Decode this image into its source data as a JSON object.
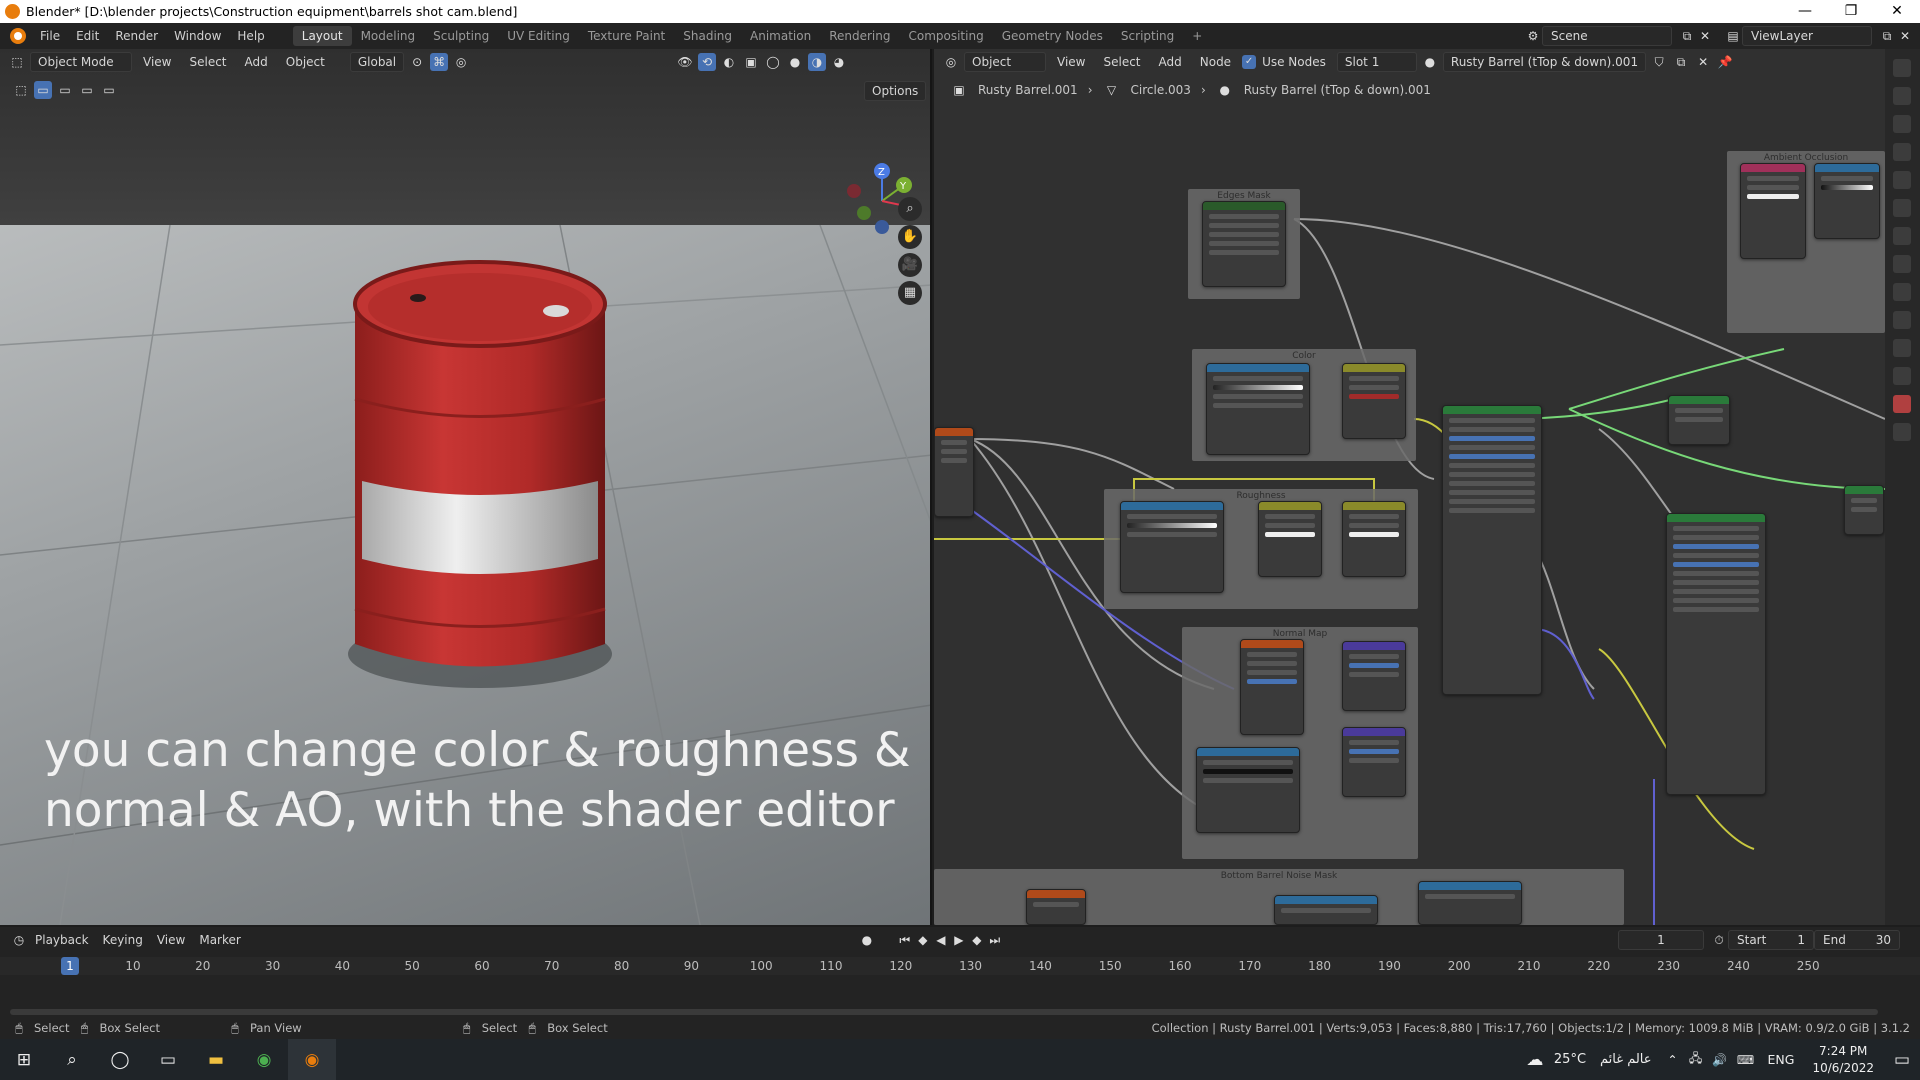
{
  "window": {
    "title": "Blender* [D:\\blender projects\\Construction equipment\\barrels shot cam.blend]",
    "minimize": "—",
    "maximize": "❐",
    "close": "✕"
  },
  "menu": [
    "File",
    "Edit",
    "Render",
    "Window",
    "Help"
  ],
  "workspaces": [
    "Layout",
    "Modeling",
    "Sculpting",
    "UV Editing",
    "Texture Paint",
    "Shading",
    "Animation",
    "Rendering",
    "Compositing",
    "Geometry Nodes",
    "Scripting",
    "+"
  ],
  "scene": {
    "label": "Scene",
    "viewlayer": "ViewLayer"
  },
  "viewport": {
    "mode": "Object Mode",
    "menu": [
      "View",
      "Select",
      "Add",
      "Object"
    ],
    "transform": "Global",
    "options": "Options",
    "overlay_text": "you can change color & roughness & normal & AO, with the shader editor",
    "gizmo": {
      "z": "Z",
      "y": "Y",
      "x": "X"
    }
  },
  "node_editor": {
    "object": "Object",
    "menu": [
      "View",
      "Select",
      "Add",
      "Node"
    ],
    "use_nodes": "Use Nodes",
    "slot": "Slot 1",
    "material": "Rusty Barrel (tTop & down).001",
    "breadcrumb": [
      "Rusty Barrel.001",
      "Circle.003",
      "Rusty Barrel (tTop & down).001"
    ],
    "frames": [
      "Edges Mask",
      "Color",
      "Roughness",
      "Normal Map",
      "Ambient Occlusion",
      "Bottom Barrel Noise Mask"
    ]
  },
  "timeline": {
    "menu": [
      "Playback",
      "Keying",
      "View",
      "Marker"
    ],
    "current_frame": "1",
    "start_label": "Start",
    "start": "1",
    "end_label": "End",
    "end": "30",
    "ticks": [
      "1",
      "10",
      "20",
      "30",
      "40",
      "50",
      "60",
      "70",
      "80",
      "90",
      "100",
      "110",
      "120",
      "130",
      "140",
      "150",
      "160",
      "170",
      "180",
      "190",
      "200",
      "210",
      "220",
      "230",
      "240",
      "250"
    ]
  },
  "status": {
    "left": [
      "Select",
      "Box Select",
      "Pan View",
      "Select",
      "Box Select"
    ],
    "right": "Collection | Rusty Barrel.001 | Verts:9,053 | Faces:8,880 | Tris:17,760 | Objects:1/2 | Memory: 1009.8 MiB | VRAM: 0.9/2.0 GiB | 3.1.2"
  },
  "taskbar": {
    "temp": "25°C",
    "weather": "عالم غائم",
    "lang": "ENG",
    "time": "7:24 PM",
    "date": "10/6/2022"
  },
  "colors": {
    "blender_orange": "#e87d0d",
    "accent_blue": "#4772b3",
    "barrel_red": "#b52a28"
  }
}
